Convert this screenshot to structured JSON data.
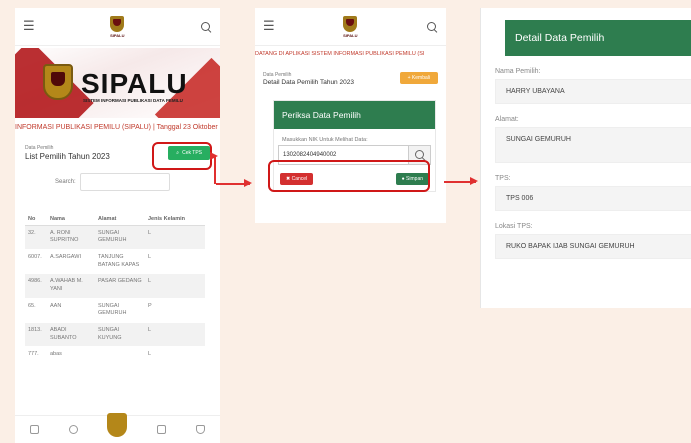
{
  "screen1": {
    "app_title": "SIPALU",
    "app_subtitle": "SISTEM INFORMASI PUBLIKASI DATA PEMILU",
    "marquee": "INFORMASI PUBLIKASI PEMILU (SIPALU)  |  Tanggal 23 Oktober",
    "card_small": "Data Pemilih",
    "card_title": "List Pemilih Tahun 2023",
    "cek_tps_label": "Cek TPS",
    "search_label": "Search:",
    "columns": [
      "No",
      "Nama",
      "Alamat",
      "Jenis Kelamin"
    ],
    "rows": [
      [
        "32.",
        "A. RONI SUPRITNO",
        "SUNGAI GEMURUH",
        "L"
      ],
      [
        "6007.",
        "A.SARGAWI",
        "TANJUNG BATANG KAPAS",
        "L"
      ],
      [
        "4986.",
        "A.WAHAB M. YANI",
        "PASAR GEDANG",
        "L"
      ],
      [
        "65.",
        "AAN",
        "SUNGAI GEMURUH",
        "P"
      ],
      [
        "1813.",
        "ABADI SUBANTO",
        "SUNGAI KUYUNG",
        "L"
      ],
      [
        "777.",
        "abas",
        "",
        "L"
      ]
    ]
  },
  "screen2": {
    "marquee": "DATANG DI APLIKASI SISTEM INFORMASI PUBLIKASI PEMILU (SI",
    "card_small": "Data Pemilih",
    "card_title": "Detail Data Pemilih Tahun 2023",
    "kembali_label": "Kembali",
    "modal_title": "Periksa Data Pemilih",
    "modal_label": "Masukkan NIK Untuk Melihat Data:",
    "nik_value": "1302082404940002",
    "cancel_label": "Cancel",
    "simpan_label": "Simpan"
  },
  "screen3": {
    "header": "Detail Data Pemilih",
    "fields": [
      {
        "label": "Nama Pemilih:",
        "value": "HARRY UBAYANA"
      },
      {
        "label": "Alamat:",
        "value": "SUNGAI GEMURUH"
      },
      {
        "label": "TPS:",
        "value": "TPS 006"
      },
      {
        "label": "Lokasi TPS:",
        "value": "RUKO BAPAK IJAB SUNGAI GEMURUH"
      }
    ]
  },
  "colors": {
    "accent_green": "#2e7d4f",
    "button_green": "#27ae60",
    "highlight_red": "#d01818",
    "brand_red": "#b3181c",
    "background": "#fbefe6"
  }
}
